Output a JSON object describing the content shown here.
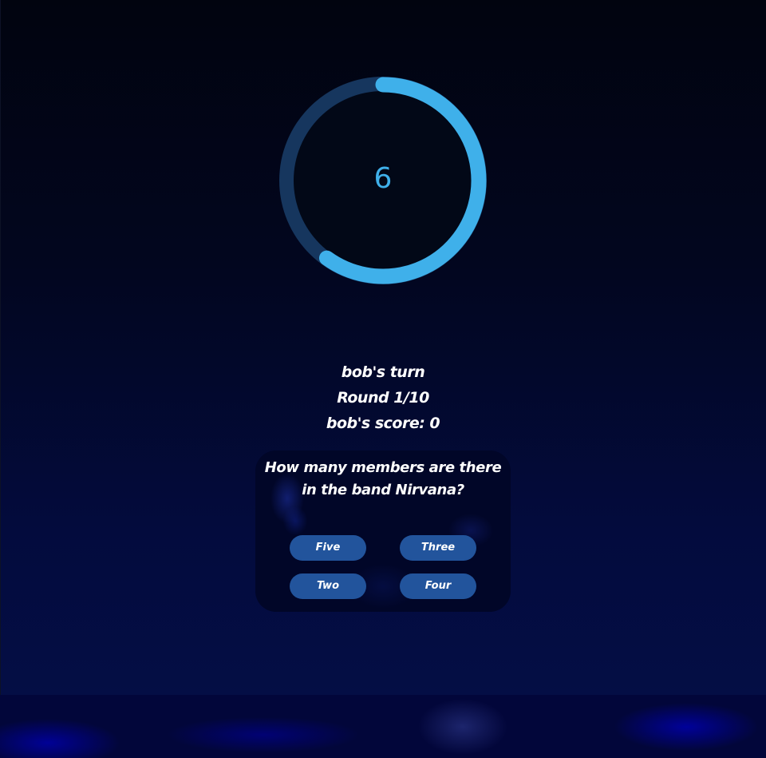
{
  "timer": {
    "value": "6",
    "progress": 0.6,
    "color": "#3fb0ea",
    "track_color": "#16365e"
  },
  "status": {
    "turn": "bob's turn",
    "round": "Round 1/10",
    "score": "bob's score: 0"
  },
  "question": {
    "text": "How many members are there in the band Nirvana?",
    "answers": [
      "Five",
      "Three",
      "Two",
      "Four"
    ]
  },
  "colors": {
    "answer_button": "#22549c",
    "text": "#ffffff"
  }
}
